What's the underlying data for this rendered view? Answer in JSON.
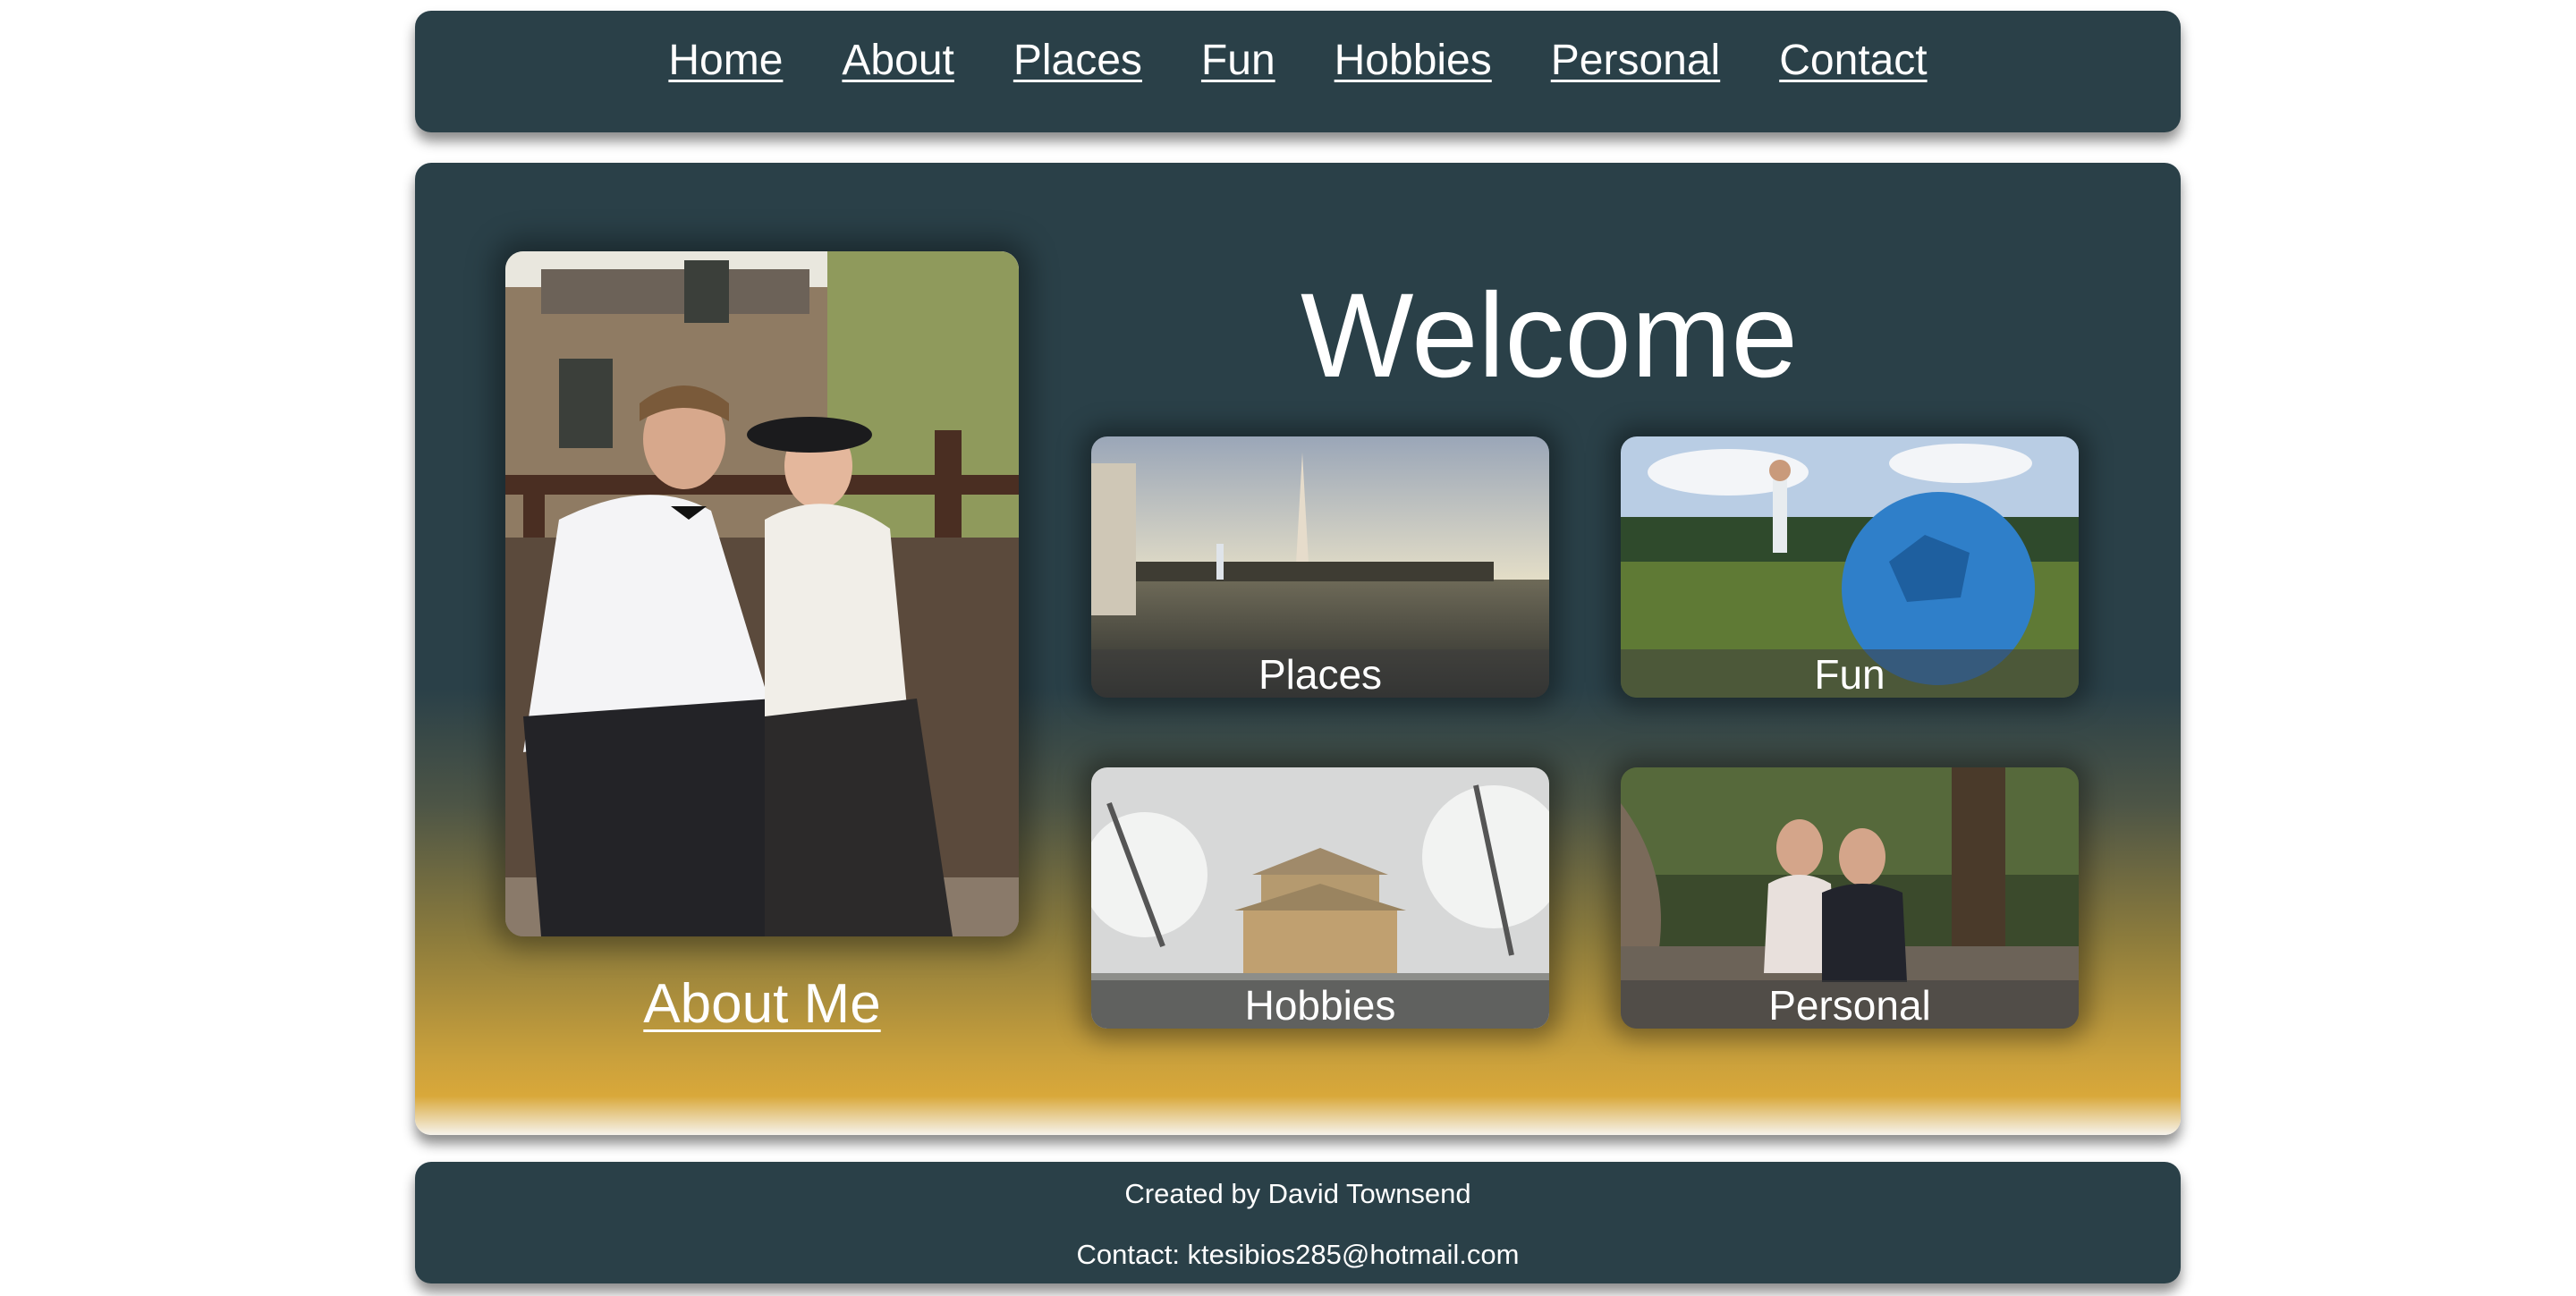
{
  "nav": {
    "items": [
      {
        "label": "Home"
      },
      {
        "label": "About"
      },
      {
        "label": "Places"
      },
      {
        "label": "Fun"
      },
      {
        "label": "Hobbies"
      },
      {
        "label": "Personal"
      },
      {
        "label": "Contact"
      }
    ]
  },
  "main": {
    "welcome": "Welcome",
    "about_link": "About Me",
    "tiles": {
      "places": "Places",
      "fun": "Fun",
      "hobbies": "Hobbies",
      "personal": "Personal"
    }
  },
  "footer": {
    "credit": "Created by David Townsend",
    "contact": "Contact: ktesibios285@hotmail.com"
  },
  "colors": {
    "panel": "#2a4048",
    "gold": "#d9a83a",
    "text": "#ffffff"
  }
}
